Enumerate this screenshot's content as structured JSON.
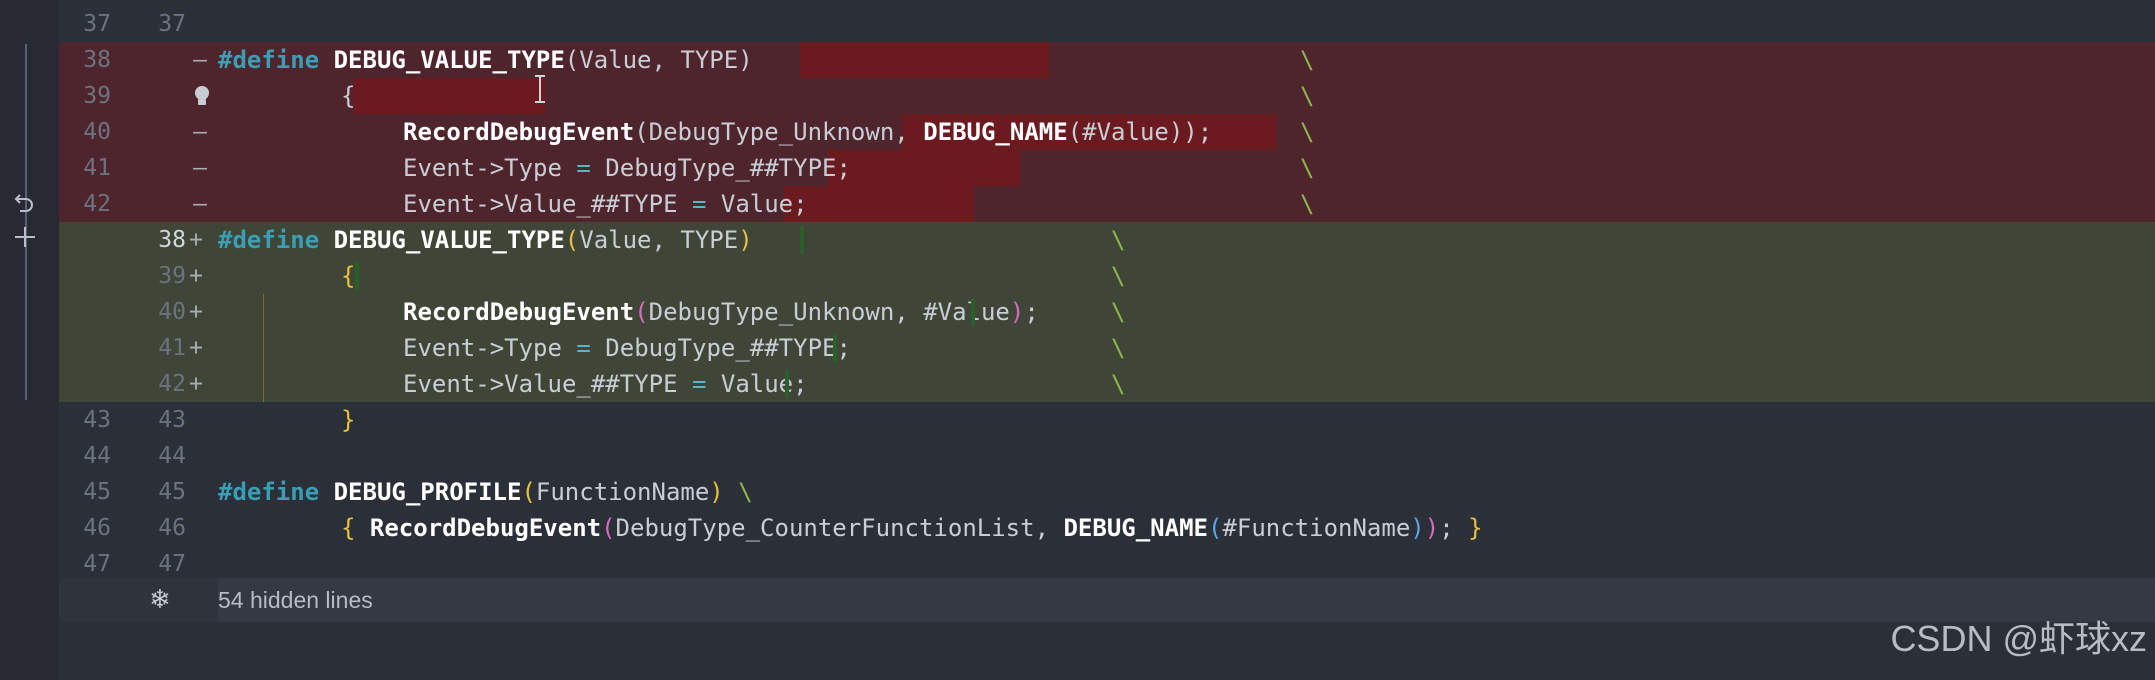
{
  "lines": [
    {
      "old": "37",
      "new": "37"
    },
    {
      "old": "38",
      "new": "",
      "marker": "—"
    },
    {
      "old": "39",
      "new": "",
      "marker": "bulb"
    },
    {
      "old": "40",
      "new": "",
      "marker": "—"
    },
    {
      "old": "41",
      "new": "",
      "marker": "—"
    },
    {
      "old": "42",
      "new": "",
      "marker": "—"
    },
    {
      "old": "",
      "new": "38",
      "marker": "+"
    },
    {
      "old": "",
      "new": "39",
      "marker": "+"
    },
    {
      "old": "",
      "new": "40",
      "marker": "+"
    },
    {
      "old": "",
      "new": "41",
      "marker": "+"
    },
    {
      "old": "",
      "new": "42",
      "marker": "+"
    },
    {
      "old": "43",
      "new": "43"
    },
    {
      "old": "44",
      "new": "44"
    },
    {
      "old": "45",
      "new": "45"
    },
    {
      "old": "46",
      "new": "46"
    },
    {
      "old": "47",
      "new": "47"
    }
  ],
  "code": {
    "define": "#define",
    "macro_value_type": "DEBUG_VALUE_TYPE",
    "params_value_type": "Value, TYPE",
    "open_brace": "{",
    "close_brace": "}",
    "record_fn": "RecordDebugEvent",
    "arg_unknown": "DebugType_Unknown, ",
    "debug_name": "DEBUG_NAME",
    "hash_value": "#Value",
    "event_type_lhs": "Event->Type ",
    "eq": "=",
    "event_type_rhs": " DebugType_##TYPE;",
    "event_value_lhs": "Event->Value_##TYPE ",
    "event_value_rhs": " Value;",
    "semicolon": ";",
    "backslash": "\\",
    "macro_profile": "DEBUG_PROFILE",
    "param_function_name": "FunctionName",
    "arg_counter": "DebugType_CounterFunctionList, ",
    "hash_function_name": "#FunctionName",
    "comma_space": ", "
  },
  "footer": {
    "hidden_lines_label": "54 hidden lines",
    "watermark": "CSDN @虾球xz"
  },
  "icons": [
    "revert-icon",
    "add-icon",
    "lightbulb-icon",
    "snowflake-icon",
    "text-cursor-icon"
  ],
  "colors": {
    "deleted_bg": "#4f252d",
    "deleted_highlight": "#6b1b20",
    "added_bg": "#3f4637",
    "keyword": "#3a9fb5",
    "paren_yellow": "#e8c13c",
    "paren_pink": "#d46cc0",
    "paren_blue": "#5ba6e8"
  }
}
